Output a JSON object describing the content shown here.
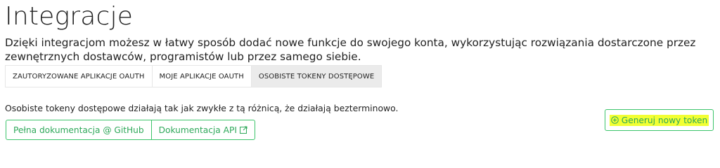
{
  "header": {
    "title": "Integracje",
    "intro": "Dzięki integracjom możesz w łatwy sposób dodać nowe funkcje do swojego konta, wykorzystując rozwiązania dostarczone przez zewnętrznych dostawców, programistów lub przez samego siebie."
  },
  "tabs": [
    {
      "label": "Zautoryzowane aplikacje OAuth",
      "active": false
    },
    {
      "label": "Moje aplikacje OAuth",
      "active": false
    },
    {
      "label": "Osobiste tokeny dostępowe",
      "active": true
    }
  ],
  "content": {
    "description": "Osobiste tokeny dostępowe działają tak jak zwykłe z tą różnicą, że działają bezterminowo.",
    "doc_buttons": {
      "github_label": "Pełna dokumentacja @ GitHub",
      "api_label": "Dokumentacja API",
      "api_icon": "external-link-icon"
    },
    "generate_button": {
      "label": "Generuj nowy token",
      "icon": "plus-circle-icon"
    }
  },
  "colors": {
    "accent": "#3cc46a",
    "accent_text": "#2fa85a",
    "highlight": "#f2ff33",
    "active_tab_bg": "#ebebeb"
  }
}
